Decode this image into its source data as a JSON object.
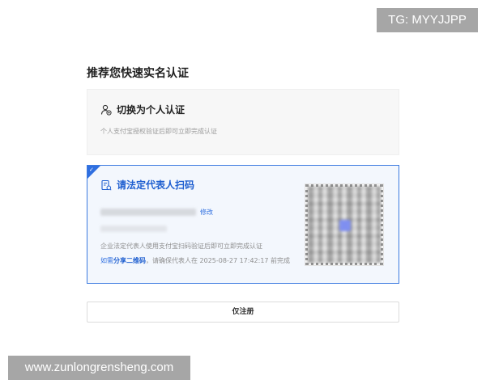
{
  "section_title": "推荐您快速实名认证",
  "personal_card": {
    "icon": "person-switch-icon",
    "label": "切换为个人认证",
    "description": "个人支付宝授权验证后即可立即完成认证"
  },
  "legal_card": {
    "icon": "scan-document-icon",
    "label": "请法定代表人扫码",
    "edit_label": "修改",
    "description": "企业法定代表人使用支付宝扫码验证后即可立即完成认证",
    "share_prefix": "如需",
    "share_link": "分享二维码",
    "share_suffix": "，请确保代表人在 2025-08-27 17:42:17 前完成",
    "accent_color": "#2f6fe0"
  },
  "qr_code": {
    "icon": "qr-code-icon"
  },
  "register_button_label": "仅注册",
  "watermarks": {
    "top_right": "TG: MYYJJPP",
    "bottom_left": "www.zunlongrensheng.com"
  }
}
